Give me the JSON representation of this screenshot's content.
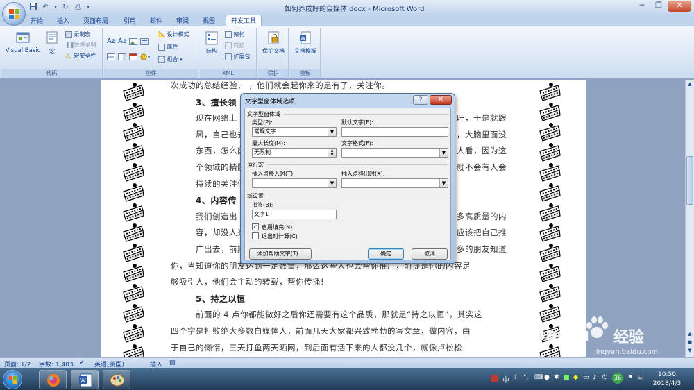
{
  "window": {
    "title": "如何养成好的自媒体.docx - Microsoft Word",
    "minimize": "─",
    "maximize": "❐",
    "close": "✕"
  },
  "tabs": [
    {
      "label": "开始"
    },
    {
      "label": "插入"
    },
    {
      "label": "页面布局"
    },
    {
      "label": "引用"
    },
    {
      "label": "邮件"
    },
    {
      "label": "审阅"
    },
    {
      "label": "视图"
    },
    {
      "label": "开发工具",
      "active": true
    }
  ],
  "ribbon": {
    "code": {
      "label": "代码",
      "visual_basic": "Visual Basic",
      "macros": "宏",
      "record_macro": "录制宏",
      "pause_recording": "暂停录制",
      "macro_security": "宏安全性"
    },
    "controls": {
      "label": "控件",
      "aa1": "Aa",
      "aa2": "Aa",
      "design_mode": "设计模式",
      "properties": "属性",
      "group": "组合"
    },
    "xml": {
      "label": "XML",
      "structure": "结构",
      "schema": "架构",
      "transform": "转换",
      "expansion_packs": "扩展包"
    },
    "protect": {
      "label": "保护",
      "protect_document": "保护文档"
    },
    "templates": {
      "label": "模板",
      "document_template": "文档模板"
    }
  },
  "document": {
    "lines": [
      {
        "text": "次成功的总结经验，  ，他们就会起你来的是有了，关注你。",
        "type": "p"
      },
      {
        "text": "3、擅长领",
        "type": "h"
      },
      {
        "text": "现在网络上",
        "type": "p",
        "right": "旺，于是就跟"
      },
      {
        "text": "风，自己也去写",
        "type": "p",
        "right": "，大脑里面没"
      },
      {
        "text": "东西，怎么能写",
        "type": "p",
        "right": "人看，因为这"
      },
      {
        "text": "个领域的精髓、",
        "type": "p",
        "right": "就不会有人会"
      },
      {
        "text": "持续的关注你，",
        "type": "p",
        "right": ""
      },
      {
        "text": "4、内容传",
        "type": "h"
      },
      {
        "text": "我们创造出",
        "type": "p",
        "right": "多高质量的内"
      },
      {
        "text": "容，却没人来浏",
        "type": "p",
        "right": "应该把自己推"
      },
      {
        "text": "广出去，前期我",
        "type": "p",
        "right": "多的朋友知道"
      },
      {
        "text": "你，当知道你的朋友达到一定数量，那么这些人也会帮你推广，前提是你的内容足",
        "type": "p"
      },
      {
        "text": "够吸引人，他们会主动的转载，帮你传播!",
        "type": "p"
      },
      {
        "text": "5、持之以恒",
        "type": "h"
      },
      {
        "text": "前面的 4 点你都能做好之后你还需要有这个品质，那就是“持之以恒”，其实这",
        "type": "p"
      },
      {
        "text": "四个字是打败绝大多数自媒体人，前面几天大家都兴致勃勃的写文章，做内容，由",
        "type": "p"
      },
      {
        "text": "于自己的懒惰，三天打鱼两天晒网，到后面有活下来的人都没几个，就像卢松松",
        "type": "p"
      }
    ]
  },
  "dialog": {
    "title": "文字型窗体域选项",
    "help": "?",
    "close": "✕",
    "section_field": "文字型窗体域",
    "type_label": "类型(P):",
    "type_value": "常规文字",
    "default_label": "默认文字(E):",
    "default_value": "",
    "maxlen_label": "最大长度(M):",
    "maxlen_value": "无限制",
    "format_label": "文字格式(F):",
    "format_value": "",
    "section_macro": "运行宏",
    "entry_label": "插入点移入时(T):",
    "entry_value": "",
    "exit_label": "插入点移出时(X):",
    "exit_value": "",
    "section_settings": "域设置",
    "bookmark_label": "书签(B):",
    "bookmark_value": "文字1",
    "fill_in_label": "启用填充(N)",
    "fill_in_checked": true,
    "calc_label": "退出时计算(C)",
    "calc_checked": false,
    "add_help_button": "添加帮助文字(T)...",
    "ok_button": "确定",
    "cancel_button": "取消"
  },
  "statusbar": {
    "page": "页面: 1/2",
    "words": "字数: 1,403",
    "language": "英语(美国)",
    "insert": "插入"
  },
  "taskbar": {
    "time": "10:50",
    "date": "2018/4/3",
    "badge": "36",
    "ime": "中"
  },
  "watermark": {
    "brand": "Baidu",
    "brand_cn": "经验",
    "url": "jingyan.baidu.com"
  }
}
